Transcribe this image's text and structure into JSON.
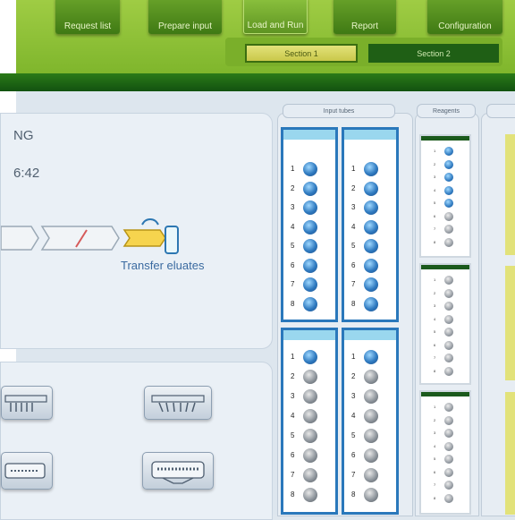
{
  "header": {
    "nav": [
      {
        "label": "Request list",
        "active": false
      },
      {
        "label": "Prepare input",
        "active": false
      },
      {
        "label": "Load and Run",
        "active": true
      },
      {
        "label": "Report",
        "active": false
      },
      {
        "label": "Configuration",
        "active": false
      }
    ],
    "sections": [
      "Section 1",
      "Section 2"
    ]
  },
  "status": {
    "text": "NG",
    "time": "6:42"
  },
  "workflow": {
    "transfer_label": "Transfer eluates"
  },
  "columns": {
    "input_tubes": "Input tubes",
    "reagents": "Reagents"
  },
  "racks": {
    "top_left": {
      "numbers": [
        "1",
        "2",
        "3",
        "4",
        "5",
        "6",
        "7",
        "8"
      ],
      "filled": [
        true,
        true,
        true,
        true,
        true,
        true,
        true,
        true
      ]
    },
    "top_right": {
      "numbers": [
        "1",
        "2",
        "3",
        "4",
        "5",
        "6",
        "7",
        "8"
      ],
      "filled": [
        true,
        true,
        true,
        true,
        true,
        true,
        true,
        true
      ]
    },
    "bottom_left": {
      "numbers": [
        "1",
        "2",
        "3",
        "4",
        "5",
        "6",
        "7",
        "8"
      ],
      "filled": [
        true,
        false,
        false,
        false,
        false,
        false,
        false,
        false
      ]
    },
    "bottom_right": {
      "numbers": [
        "1",
        "2",
        "3",
        "4",
        "5",
        "6",
        "7",
        "8"
      ],
      "filled": [
        true,
        false,
        false,
        false,
        false,
        false,
        false,
        false
      ]
    }
  },
  "reagents": [
    {
      "numbers": [
        "1",
        "2",
        "3",
        "4",
        "5",
        "6",
        "7",
        "8"
      ],
      "filled": [
        true,
        true,
        true,
        true,
        true,
        false,
        false,
        false
      ]
    },
    {
      "numbers": [
        "1",
        "2",
        "3",
        "4",
        "5",
        "6",
        "7",
        "8"
      ],
      "filled": [
        false,
        false,
        false,
        false,
        false,
        false,
        false,
        false
      ]
    },
    {
      "numbers": [
        "1",
        "2",
        "3",
        "4",
        "5",
        "6",
        "7",
        "8"
      ],
      "filled": [
        false,
        false,
        false,
        false,
        false,
        false,
        false,
        false
      ]
    }
  ],
  "colors": {
    "header_green": "#8cc23e",
    "tube_blue": "#2f7ac0",
    "tube_grey": "#8f969d"
  }
}
